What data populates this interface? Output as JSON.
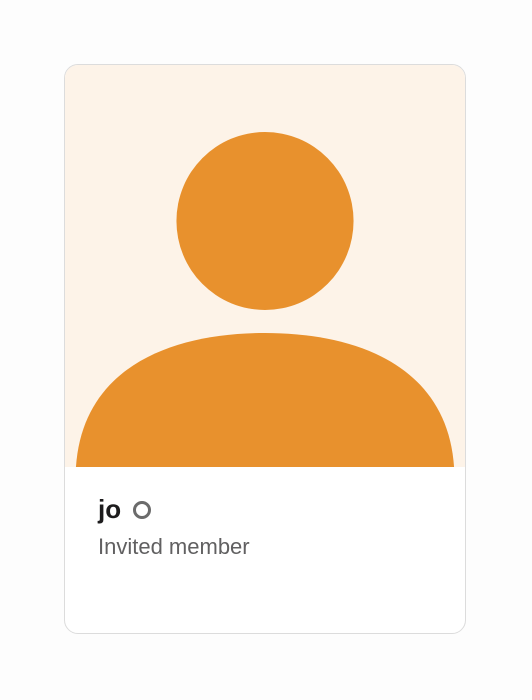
{
  "member": {
    "name": "jo",
    "role": "Invited member",
    "presence": "away"
  },
  "colors": {
    "avatar_fill": "#e8912d",
    "avatar_background": "#fdf3e8",
    "presence_ring": "#6b6b6b"
  },
  "icons": {
    "avatar": "default-person-icon",
    "presence": "presence-away-icon"
  }
}
